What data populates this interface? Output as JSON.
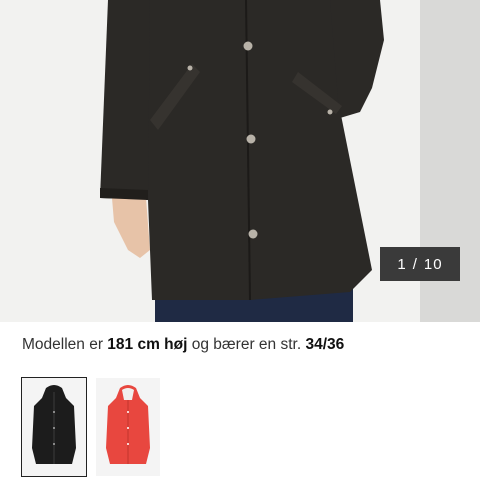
{
  "gallery": {
    "counter_current": "1",
    "counter_separator": "/",
    "counter_total": "10"
  },
  "caption": {
    "prefix": "Modellen er ",
    "height": "181 cm høj",
    "middle": " og bærer en str. ",
    "size": "34/36"
  },
  "swatches": [
    {
      "label": "black",
      "color": "#1c1c1c",
      "selected": true
    },
    {
      "label": "red",
      "color": "#e8473f",
      "selected": false
    }
  ],
  "colors": {
    "jacket": "#2b2926",
    "jeans": "#1f2a44",
    "counter_bg": "#3a3a3a"
  }
}
